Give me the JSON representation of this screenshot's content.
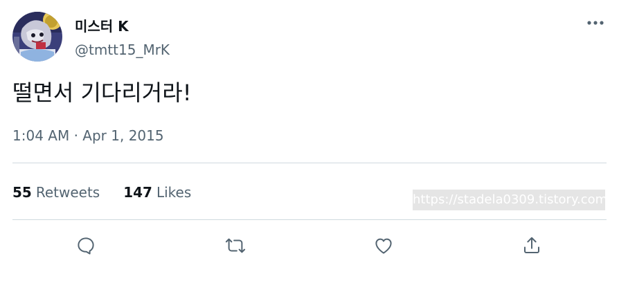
{
  "user": {
    "display_name": "미스터 K",
    "handle": "@tmtt15_MrK"
  },
  "tweet": {
    "text": "떨면서 기다리거라!",
    "time": "1:04 AM",
    "separator": "·",
    "date": "Apr 1, 2015"
  },
  "stats": {
    "retweets_count": "55",
    "retweets_label": "Retweets",
    "likes_count": "147",
    "likes_label": "Likes"
  },
  "watermark": "https://stadela0309.tistory.com",
  "icons": {
    "more": "more-horizontal-icon",
    "reply": "reply-icon",
    "retweet": "retweet-icon",
    "like": "heart-icon",
    "share": "share-icon"
  },
  "colors": {
    "text_primary": "#0f1419",
    "text_secondary": "#536471",
    "divider": "#cfd9de"
  }
}
